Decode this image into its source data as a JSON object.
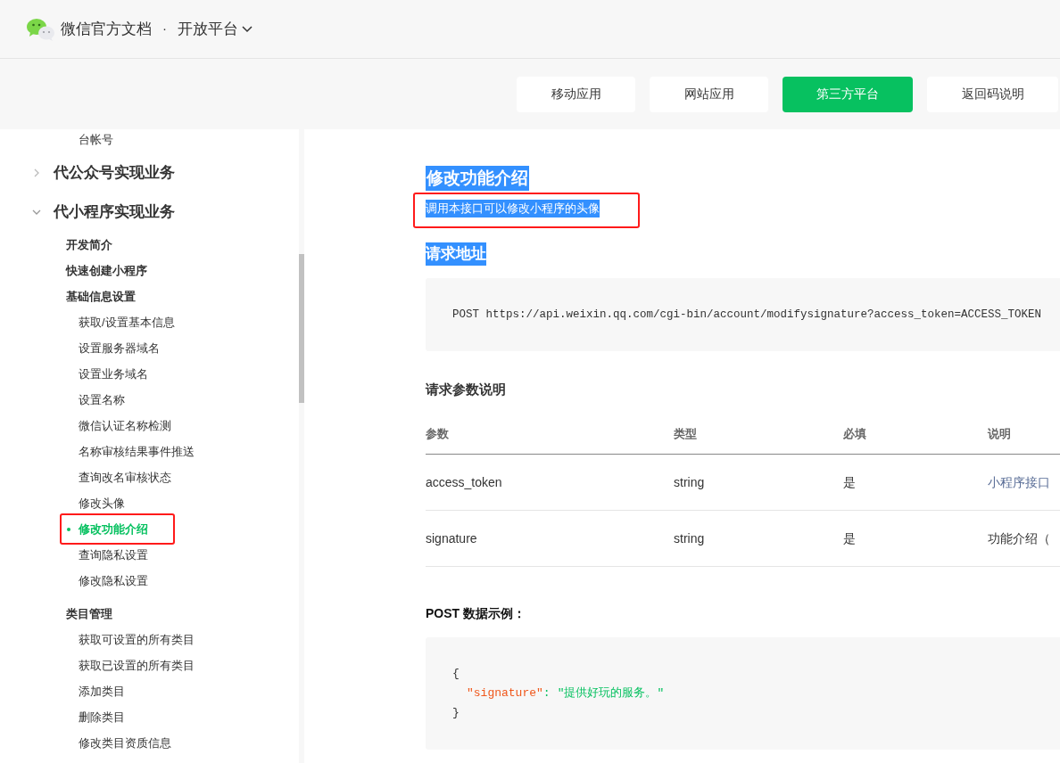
{
  "header": {
    "brand": "微信官方文档",
    "separator": "·",
    "product": "开放平台"
  },
  "nav_buttons": [
    {
      "label": "移动应用",
      "selected": false
    },
    {
      "label": "网站应用",
      "selected": false
    },
    {
      "label": "第三方平台",
      "selected": true
    },
    {
      "label": "返回码说明",
      "selected": false
    }
  ],
  "sidebar": {
    "items": [
      {
        "kind": "leaf",
        "label": "台帐号"
      },
      {
        "kind": "section",
        "label": "代公众号实现业务",
        "expanded": false
      },
      {
        "kind": "section",
        "label": "代小程序实现业务",
        "expanded": true,
        "children": [
          {
            "label": "开发简介"
          },
          {
            "label": "快速创建小程序"
          },
          {
            "label": "基础信息设置",
            "children": [
              {
                "label": "获取/设置基本信息",
                "selected": false,
                "annotated": false
              },
              {
                "label": "设置服务器域名",
                "selected": false,
                "annotated": false
              },
              {
                "label": "设置业务域名",
                "selected": false,
                "annotated": false
              },
              {
                "label": "设置名称",
                "selected": false,
                "annotated": false
              },
              {
                "label": "微信认证名称检测",
                "selected": false,
                "annotated": false
              },
              {
                "label": "名称审核结果事件推送",
                "selected": false,
                "annotated": false
              },
              {
                "label": "查询改名审核状态",
                "selected": false,
                "annotated": false
              },
              {
                "label": "修改头像",
                "selected": false,
                "annotated": false
              },
              {
                "label": "修改功能介绍",
                "selected": true,
                "annotated": true
              },
              {
                "label": "查询隐私设置",
                "selected": false,
                "annotated": false
              },
              {
                "label": "修改隐私设置",
                "selected": false,
                "annotated": false
              }
            ]
          },
          {
            "label": "类目管理",
            "children": [
              {
                "label": "获取可设置的所有类目",
                "selected": false,
                "annotated": false
              },
              {
                "label": "获取已设置的所有类目",
                "selected": false,
                "annotated": false
              },
              {
                "label": "添加类目",
                "selected": false,
                "annotated": false
              },
              {
                "label": "删除类目",
                "selected": false,
                "annotated": false
              },
              {
                "label": "修改类目资质信息",
                "selected": false,
                "annotated": false
              }
            ]
          }
        ]
      }
    ]
  },
  "content": {
    "title": {
      "text": "修改功能介绍",
      "highlighted": true
    },
    "description": {
      "text": "调用本接口可以修改小程序的头像",
      "highlighted": true,
      "annotated": true
    },
    "request_url_heading": {
      "text": "请求地址",
      "highlighted": true
    },
    "request_url": "POST https://api.weixin.qq.com/cgi-bin/account/modifysignature?access_token=ACCESS_TOKEN",
    "params_heading": "请求参数说明",
    "table": {
      "columns": [
        "参数",
        "类型",
        "必填",
        "说明"
      ],
      "rows": [
        [
          {
            "text": "access_token",
            "kind": "plain"
          },
          {
            "text": "string",
            "kind": "plain"
          },
          {
            "text": "是",
            "kind": "plain"
          },
          {
            "text": "小程序接口",
            "kind": "link"
          }
        ],
        [
          {
            "text": "signature",
            "kind": "plain"
          },
          {
            "text": "string",
            "kind": "plain"
          },
          {
            "text": "是",
            "kind": "plain"
          },
          {
            "text": "功能介绍（",
            "kind": "plain"
          }
        ]
      ]
    },
    "example_heading": "POST 数据示例：",
    "example_code": {
      "open": "{",
      "key": "\"signature\"",
      "colon": ":",
      "value": "\"提供好玩的服务。\"",
      "close": "}"
    }
  }
}
